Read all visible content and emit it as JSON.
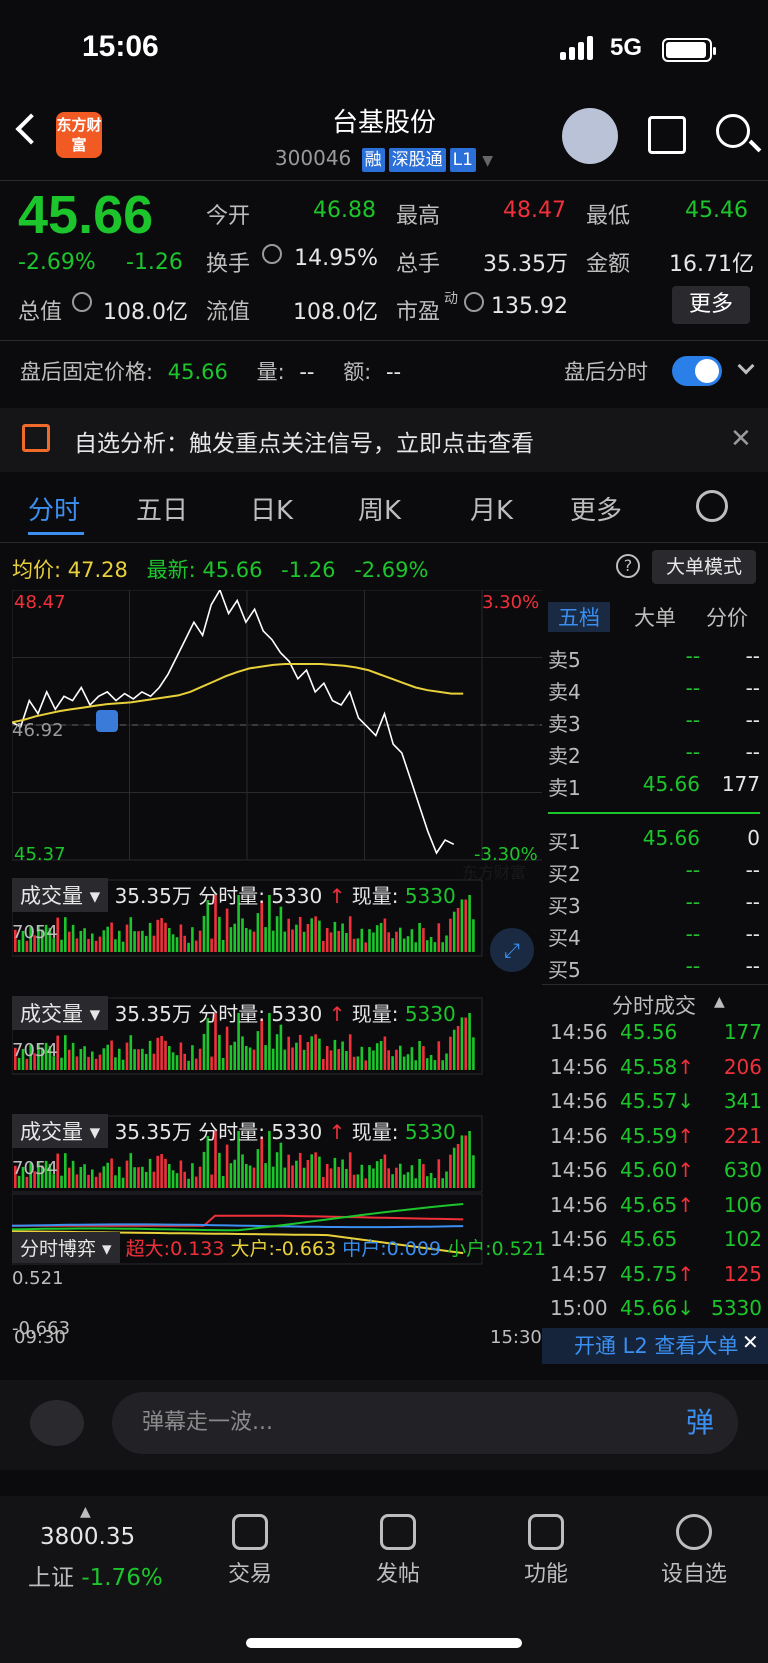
{
  "status": {
    "time": "15:06",
    "network": "5G"
  },
  "header": {
    "title": "台基股份",
    "code": "300046",
    "tags": [
      "融",
      "深股通",
      "L1"
    ],
    "logo_text": "东方财富"
  },
  "quote": {
    "price": "45.66",
    "change_pct": "-2.69%",
    "change": "-1.26",
    "open_label": "今开",
    "open": "46.88",
    "high_label": "最高",
    "high": "48.47",
    "low_label": "最低",
    "low": "45.46",
    "turnover_label": "换手",
    "turnover": "14.95%",
    "volume_label": "总手",
    "volume": "35.35万",
    "amount_label": "金额",
    "amount": "16.71亿",
    "mktcap_label": "总值",
    "mktcap": "108.0亿",
    "float_label": "流值",
    "float": "108.0亿",
    "pe_label": "市盈",
    "pe_sup": "动",
    "pe": "135.92",
    "more_button": "更多"
  },
  "afterhours": {
    "label": "盘后固定价格:",
    "price": "45.66",
    "vol_label": "量:",
    "vol": "--",
    "amt_label": "额:",
    "amt": "--",
    "toggle_label": "盘后分时",
    "enabled": true
  },
  "notice": {
    "text": "自选分析：触发重点关注信号，立即点击查看"
  },
  "tabs": [
    "分时",
    "五日",
    "日K",
    "周K",
    "月K",
    "更多"
  ],
  "chart_header": {
    "avg_label": "均价:",
    "avg": "47.28",
    "last_label": "最新:",
    "last": "45.66",
    "chg": "-1.26",
    "pct": "-2.69%",
    "mode_button": "大单模式"
  },
  "chart_data": {
    "type": "line",
    "title": "",
    "y_max_label": "48.47",
    "y_min_label": "45.37",
    "y_mid_label": "46.92",
    "pct_max_label": "3.30%",
    "pct_min_label": "-3.30%",
    "ylim": [
      45.37,
      48.47
    ],
    "x_start": "09:30",
    "x_end": "15:30",
    "price": [
      46.95,
      46.9,
      47.2,
      47.05,
      47.3,
      47.1,
      47.25,
      47.2,
      47.35,
      47.15,
      47.25,
      47.3,
      47.2,
      47.28,
      47.22,
      47.3,
      47.25,
      47.35,
      47.5,
      47.7,
      47.9,
      48.1,
      47.95,
      48.3,
      48.47,
      48.2,
      48.35,
      48.1,
      48.25,
      48.0,
      47.9,
      47.75,
      47.65,
      47.45,
      47.55,
      47.3,
      47.4,
      47.2,
      47.15,
      47.3,
      47.0,
      46.9,
      46.8,
      47.05,
      46.7,
      46.6,
      46.3,
      46.0,
      45.7,
      45.45,
      45.6,
      45.55
    ],
    "average": [
      46.95,
      46.98,
      47.02,
      47.05,
      47.08,
      47.1,
      47.12,
      47.14,
      47.16,
      47.17,
      47.18,
      47.2,
      47.22,
      47.24,
      47.26,
      47.3,
      47.36,
      47.42,
      47.48,
      47.53,
      47.57,
      47.59,
      47.61,
      47.62,
      47.62,
      47.62,
      47.62,
      47.61,
      47.6,
      47.58,
      47.55,
      47.5,
      47.45,
      47.4,
      47.35,
      47.32,
      47.3,
      47.28,
      47.28
    ],
    "volume_label": "成交量",
    "volume_total": "35.35万",
    "bar_vol_label": "分时量:",
    "bar_vol": "5330",
    "now_label": "现量:",
    "now_vol": "5330",
    "vol_max": "7054",
    "game_label": "分时博弈",
    "game_series": [
      {
        "name": "超大",
        "value": "0.133",
        "color": "#f0303a"
      },
      {
        "name": "大户",
        "value": "-0.663",
        "color": "#e8d03a"
      },
      {
        "name": "中户",
        "value": "0.009",
        "color": "#3a8ff0"
      },
      {
        "name": "小户",
        "value": "0.521",
        "color": "#1dc52c"
      }
    ],
    "game_max": "0.521",
    "game_min": "-0.663"
  },
  "orderbook": {
    "tabs": [
      "五档",
      "大单",
      "分价"
    ],
    "asks": [
      {
        "l": "卖5",
        "p": "--",
        "v": "--"
      },
      {
        "l": "卖4",
        "p": "--",
        "v": "--"
      },
      {
        "l": "卖3",
        "p": "--",
        "v": "--"
      },
      {
        "l": "卖2",
        "p": "--",
        "v": "--"
      },
      {
        "l": "卖1",
        "p": "45.66",
        "v": "177"
      }
    ],
    "bids": [
      {
        "l": "买1",
        "p": "45.66",
        "v": "0"
      },
      {
        "l": "买2",
        "p": "--",
        "v": "--"
      },
      {
        "l": "买3",
        "p": "--",
        "v": "--"
      },
      {
        "l": "买4",
        "p": "--",
        "v": "--"
      },
      {
        "l": "买5",
        "p": "--",
        "v": "--"
      }
    ]
  },
  "trades": {
    "title": "分时成交",
    "rows": [
      {
        "t": "14:56",
        "p": "45.56",
        "a": "",
        "v": "177",
        "vc": "green"
      },
      {
        "t": "14:56",
        "p": "45.58",
        "a": "↑",
        "v": "206",
        "vc": "red"
      },
      {
        "t": "14:56",
        "p": "45.57",
        "a": "↓",
        "v": "341",
        "vc": "green"
      },
      {
        "t": "14:56",
        "p": "45.59",
        "a": "↑",
        "v": "221",
        "vc": "red"
      },
      {
        "t": "14:56",
        "p": "45.60",
        "a": "↑",
        "v": "630",
        "vc": "green"
      },
      {
        "t": "14:56",
        "p": "45.65",
        "a": "↑",
        "v": "106",
        "vc": "green"
      },
      {
        "t": "14:56",
        "p": "45.65",
        "a": "",
        "v": "102",
        "vc": "green"
      },
      {
        "t": "14:57",
        "p": "45.75",
        "a": "↑",
        "v": "125",
        "vc": "red"
      },
      {
        "t": "15:00",
        "p": "45.66",
        "a": "↓",
        "v": "5330",
        "vc": "green"
      }
    ],
    "l2_banner": "开通 L2 查看大单"
  },
  "comment": {
    "placeholder": "弹幕走一波...",
    "danmu": "弹"
  },
  "bottom_nav": {
    "index_value": "3800.35",
    "index_name": "上证",
    "index_chg": "-1.76%",
    "items": [
      "交易",
      "发帖",
      "功能",
      "设自选"
    ]
  }
}
